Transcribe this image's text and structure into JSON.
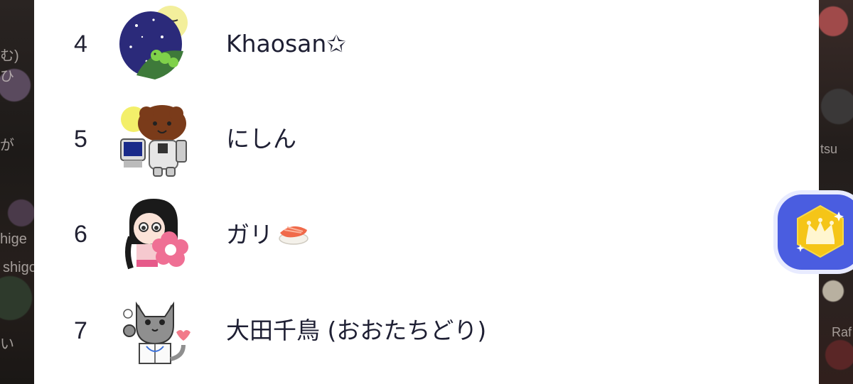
{
  "ranking": [
    {
      "rank": "4",
      "name": "Khaosan✩"
    },
    {
      "rank": "5",
      "name": "にしん"
    },
    {
      "rank": "6",
      "name": "ガリ"
    },
    {
      "rank": "7",
      "name": "大田千鳥 (おおたちどり)"
    }
  ],
  "crown_button": {
    "icon": "crown-icon"
  },
  "colors": {
    "panel": "#ffffff",
    "text": "#1e1f33",
    "badge_blue": "#4a5de0",
    "badge_gold": "#f5c518"
  }
}
